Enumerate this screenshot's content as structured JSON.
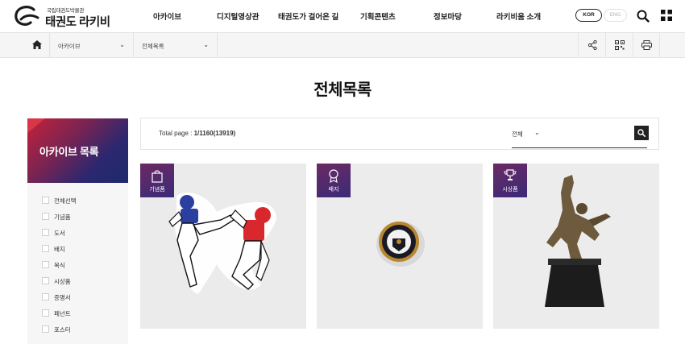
{
  "header": {
    "logo_small": "국립태권도박물관",
    "logo_main": "태권도 라키비움",
    "nav": [
      "아카이브",
      "디지털영상관",
      "태권도가 걸어온 길",
      "기획콘텐츠",
      "정보마당",
      "라키비움 소개"
    ],
    "lang_kor": "KOR",
    "lang_eng": "ENG",
    "icons": [
      "search-icon",
      "grid-menu-icon"
    ]
  },
  "location": {
    "depth1": "아카이브",
    "depth2": "전체목록",
    "tools": [
      "share-icon",
      "qr-icon",
      "print-icon"
    ]
  },
  "page": {
    "title": "전체목록"
  },
  "sidebar": {
    "title": "아카이브 목록",
    "items": [
      "전체선택",
      "기념품",
      "도서",
      "배지",
      "복식",
      "시상품",
      "증명서",
      "페넌트",
      "포스터"
    ]
  },
  "search": {
    "total_label": "Total page : ",
    "total_value": "1/1160(13919)",
    "scope": "전체",
    "placeholder": ""
  },
  "cards": [
    {
      "category": "기념품",
      "icon": "gift-bag-icon"
    },
    {
      "category": "배지",
      "icon": "medal-icon"
    },
    {
      "category": "시상품",
      "icon": "trophy-icon"
    }
  ],
  "colors": {
    "accent_red": "#c4213a",
    "accent_navy": "#1d2a6a",
    "badge_purple": "#4a2a70"
  }
}
